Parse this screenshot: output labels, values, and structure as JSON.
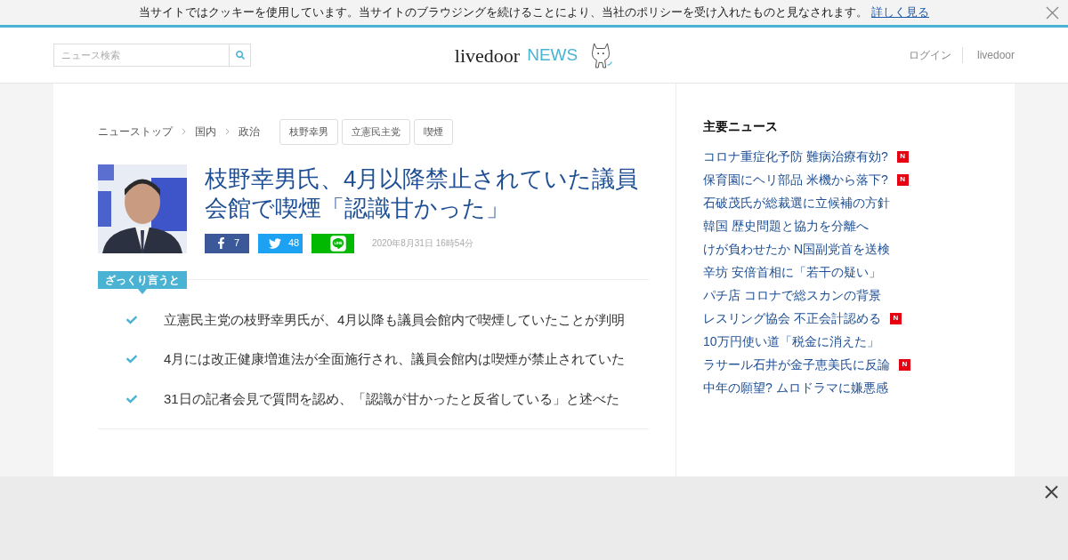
{
  "cookie_bar": {
    "text": "当サイトではクッキーを使用しています。当サイトのブラウジングを続けることにより、当社のポリシーを受け入れたものと見なされます。",
    "link": "詳しく見る"
  },
  "header": {
    "search": {
      "placeholder": "ニュース検索"
    },
    "logo": {
      "brand": "livedoor",
      "product": "NEWS"
    },
    "links": [
      "ログイン",
      "livedoor"
    ]
  },
  "breadcrumbs": [
    "ニューストップ",
    "国内",
    "政治"
  ],
  "tags": [
    "枝野幸男",
    "立憲民主党",
    "喫煙"
  ],
  "article": {
    "title": "枝野幸男氏、4月以降禁止されていた議員会館で喫煙「認識甘かった」",
    "shares": [
      {
        "kind": "facebook",
        "count": "7"
      },
      {
        "kind": "twitter",
        "count": "48"
      },
      {
        "kind": "line"
      }
    ],
    "date": "2020年8月31日 16時54分",
    "summary_label": "ざっくり言うと",
    "summary": [
      "立憲民主党の枝野幸男氏が、4月以降も議員会館内で喫煙していたことが判明",
      "4月には改正健康増進法が全面施行され、議員会館内は喫煙が禁止されていた",
      "31日の記者会見で質問を認め、「認識が甘かったと反省している」と述べた"
    ]
  },
  "sidebar": {
    "title": "主要ニュース",
    "items": [
      {
        "text": "コロナ重症化予防 難病治療有効?",
        "new": true,
        "badge": "N"
      },
      {
        "text": "保育園にヘリ部品 米機から落下?",
        "new": true,
        "badge": "N"
      },
      {
        "text": "石破茂氏が総裁選に立候補の方針",
        "new": false
      },
      {
        "text": "韓国 歴史問題と協力を分離へ",
        "new": false
      },
      {
        "text": "けが負わせたか N国副党首を送検",
        "new": false
      },
      {
        "text": "辛坊 安倍首相に「若干の疑い」",
        "new": false
      },
      {
        "text": "パチ店 コロナで総スカンの背景",
        "new": false
      },
      {
        "text": "レスリング協会 不正会計認める",
        "new": true,
        "badge": "N"
      },
      {
        "text": "10万円使い道「税金に消えた」",
        "new": false
      },
      {
        "text": "ラサール石井が金子恵美氏に反論",
        "new": true,
        "badge": "N"
      },
      {
        "text": "中年の願望? ムロドラマに嫌悪感",
        "new": false
      }
    ]
  },
  "ad_bar": {
    "closable": true
  }
}
